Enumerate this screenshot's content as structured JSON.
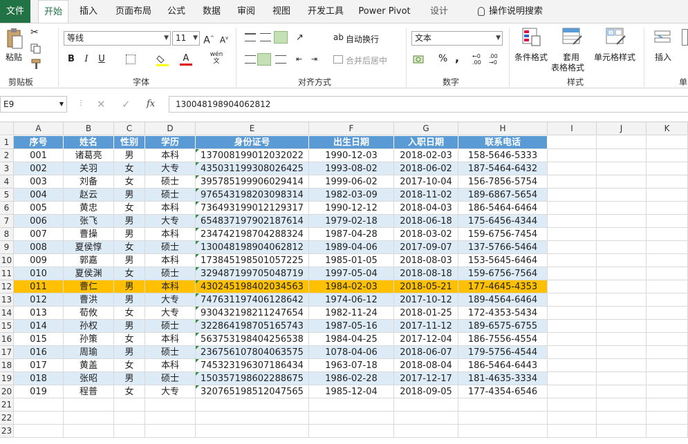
{
  "tabs": [
    {
      "label": "文件"
    },
    {
      "label": "开始"
    },
    {
      "label": "插入"
    },
    {
      "label": "页面布局"
    },
    {
      "label": "公式"
    },
    {
      "label": "数据"
    },
    {
      "label": "审阅"
    },
    {
      "label": "视图"
    },
    {
      "label": "开发工具"
    },
    {
      "label": "Power Pivot"
    },
    {
      "label": "设计"
    },
    {
      "label": "操作说明搜索"
    }
  ],
  "ribbon": {
    "paste": "粘贴",
    "clipboard": "剪贴板",
    "font_name": "等线",
    "font_size": "11",
    "font_group": "字体",
    "bold": "B",
    "italic": "I",
    "underline": "U",
    "wrap": "自动换行",
    "merge": "合并后居中",
    "align_group": "对齐方式",
    "number_format": "文本",
    "number_group": "数字",
    "cond_format": "条件格式",
    "table_format_1": "套用",
    "table_format_2": "表格格式",
    "cell_style": "单元格样式",
    "style_group": "样式",
    "insert": "插入",
    "cells_group": "单",
    "percent": "%",
    "comma": ",",
    "phonetic": "wén"
  },
  "formula_bar": {
    "name_box": "E9",
    "fx": "fx",
    "value": "130048198904062812"
  },
  "columns": [
    "A",
    "B",
    "C",
    "D",
    "E",
    "F",
    "G",
    "H",
    "I",
    "J",
    "K"
  ],
  "rows": [
    "1",
    "2",
    "3",
    "4",
    "5",
    "6",
    "7",
    "8",
    "9",
    "10",
    "11",
    "12",
    "13",
    "14",
    "15",
    "16",
    "17",
    "18",
    "19",
    "20",
    "21",
    "22",
    "23"
  ],
  "table": {
    "headers": [
      "序号",
      "姓名",
      "性别",
      "学历",
      "身份证号",
      "出生日期",
      "入职日期",
      "联系电话"
    ],
    "data": [
      [
        "001",
        "诸葛亮",
        "男",
        "本科",
        "137008199012032022",
        "1990-12-03",
        "2018-02-03",
        "158-5646-5333"
      ],
      [
        "002",
        "关羽",
        "女",
        "大专",
        "435031199308026425",
        "1993-08-02",
        "2018-06-02",
        "187-5464-6432"
      ],
      [
        "003",
        "刘备",
        "女",
        "硕士",
        "395785199906029414",
        "1999-06-02",
        "2017-10-04",
        "156-7856-5754"
      ],
      [
        "004",
        "赵云",
        "男",
        "硕士",
        "976543198203098314",
        "1982-03-09",
        "2018-11-02",
        "189-6867-5654"
      ],
      [
        "005",
        "黄忠",
        "女",
        "本科",
        "736493199012129317",
        "1990-12-12",
        "2018-04-03",
        "186-5464-6464"
      ],
      [
        "006",
        "张飞",
        "男",
        "大专",
        "654837197902187614",
        "1979-02-18",
        "2018-06-18",
        "175-6456-4344"
      ],
      [
        "007",
        "曹操",
        "男",
        "本科",
        "234742198704288324",
        "1987-04-28",
        "2018-03-02",
        "159-6756-7454"
      ],
      [
        "008",
        "夏侯惇",
        "女",
        "硕士",
        "130048198904062812",
        "1989-04-06",
        "2017-09-07",
        "137-5766-5464"
      ],
      [
        "009",
        "郭嘉",
        "男",
        "本科",
        "173845198501057225",
        "1985-01-05",
        "2018-08-03",
        "153-5645-6464"
      ],
      [
        "010",
        "夏侯渊",
        "女",
        "硕士",
        "329487199705048719",
        "1997-05-04",
        "2018-08-18",
        "159-6756-7564"
      ],
      [
        "011",
        "曹仁",
        "男",
        "本科",
        "430245198402034563",
        "1984-02-03",
        "2018-05-21",
        "177-4645-4353"
      ],
      [
        "012",
        "曹洪",
        "男",
        "大专",
        "747631197406128642",
        "1974-06-12",
        "2017-10-12",
        "189-4564-6464"
      ],
      [
        "013",
        "荀攸",
        "女",
        "大专",
        "930432198211247654",
        "1982-11-24",
        "2018-01-25",
        "172-4353-5434"
      ],
      [
        "014",
        "孙权",
        "男",
        "硕士",
        "322864198705165743",
        "1987-05-16",
        "2017-11-12",
        "189-6575-6755"
      ],
      [
        "015",
        "孙策",
        "女",
        "本科",
        "563753198404256538",
        "1984-04-25",
        "2017-12-04",
        "186-7556-4554"
      ],
      [
        "016",
        "周瑜",
        "男",
        "硕士",
        "236756107804063575",
        "1078-04-06",
        "2018-06-07",
        "179-5756-4544"
      ],
      [
        "017",
        "黄盖",
        "女",
        "本科",
        "745323196307186434",
        "1963-07-18",
        "2018-08-04",
        "186-5464-6443"
      ],
      [
        "018",
        "张昭",
        "男",
        "硕士",
        "150357198602288675",
        "1986-02-28",
        "2017-12-17",
        "181-4635-3334"
      ],
      [
        "019",
        "程普",
        "女",
        "大专",
        "320765198512047565",
        "1985-12-04",
        "2018-09-05",
        "177-4354-6546"
      ]
    ],
    "highlight_row_index": 10
  },
  "colors": {
    "accent": "#217346",
    "header": "#5b9bd5",
    "band": "#ddebf7",
    "highlight": "#ffc000"
  },
  "icons": [
    "scissors-icon",
    "copy-icon",
    "format-painter-icon",
    "lightbulb-icon",
    "cancel-icon",
    "enter-icon",
    "fx-icon"
  ]
}
